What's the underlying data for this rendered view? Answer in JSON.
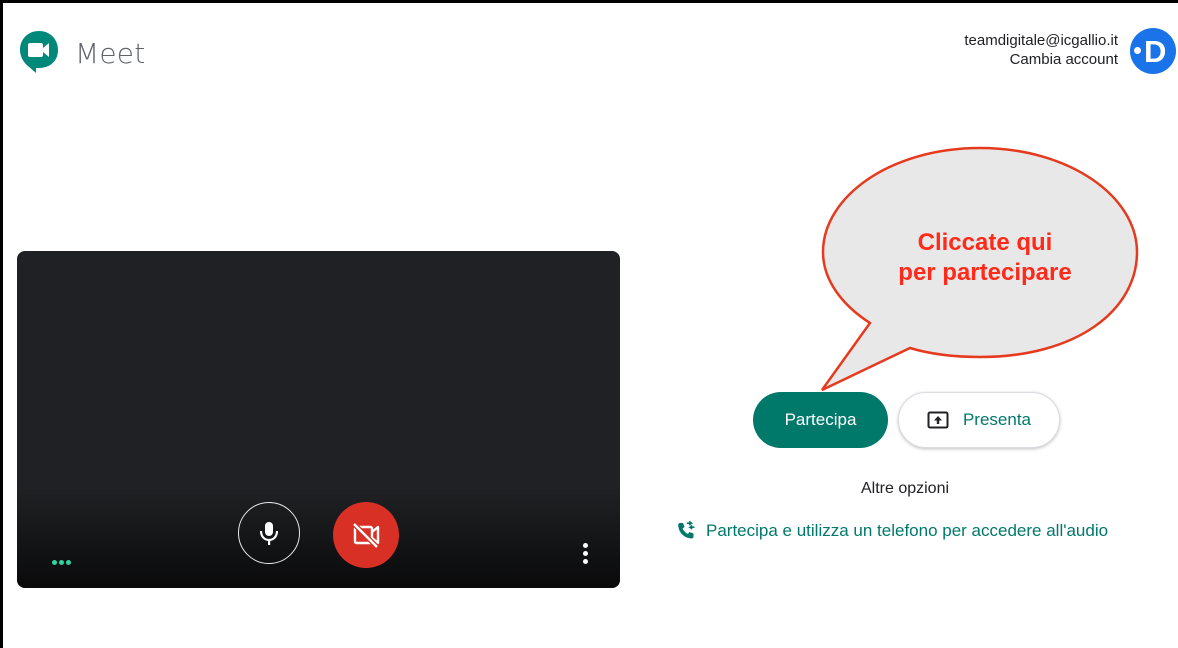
{
  "app": {
    "name": "Meet",
    "logo_icon": "google-meet-logo"
  },
  "account": {
    "email": "teamdigitale@icgallio.it",
    "switch_label": "Cambia account",
    "avatar_letter": "D",
    "avatar_color": "#1a73e8"
  },
  "preview": {
    "mic_icon": "microphone-icon",
    "camera_icon": "camera-off-icon",
    "camera_off_color": "#d93025",
    "more_icon": "more-vertical-icon",
    "audio_indicator_icon": "audio-dots-icon"
  },
  "callout": {
    "line1": "Cliccate qui",
    "line2": "per partecipare",
    "text_color": "#ff2a1a"
  },
  "actions": {
    "join_label": "Partecipa",
    "present_label": "Presenta",
    "present_icon": "present-screen-icon",
    "other_options_label": "Altre opzioni",
    "phone_join_label": "Partecipa e utilizza un telefono per accedere all'audio",
    "phone_icon": "phone-forwarded-icon",
    "accent_color": "#00796b"
  }
}
